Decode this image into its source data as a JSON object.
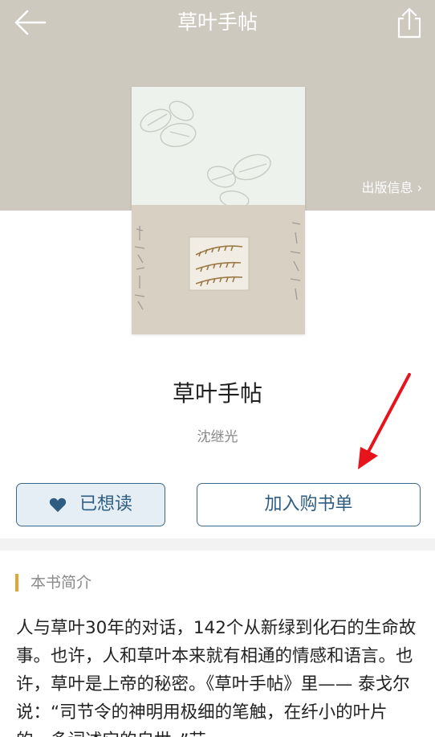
{
  "header": {
    "title": "草叶手帖",
    "back_icon": "back-arrow-icon",
    "share_icon": "share-icon",
    "publication_info_link": "出版信息 ›"
  },
  "book": {
    "title": "草叶手帖",
    "author": "沈继光"
  },
  "actions": {
    "want_read_label": "已想读",
    "want_read_icon": "heart-icon",
    "add_to_list_label": "加入购书单"
  },
  "intro": {
    "heading": "本书简介",
    "text": "人与草叶30年的对话，142个从新绿到化石的生命故事。也许，人和草叶本来就有相通的情感和语言。也许，草叶是上帝的秘密。《草叶手帖》里—— 泰戈尔说：“司节令的神明用极细的笔触，在纤小的叶片的，多词述它的自世。”芸"
  },
  "colors": {
    "header_bg": "#cdc9bf",
    "accent_blue": "#2e5d84",
    "accent_orange": "#e3a636",
    "annotation_red": "#e8141b"
  }
}
